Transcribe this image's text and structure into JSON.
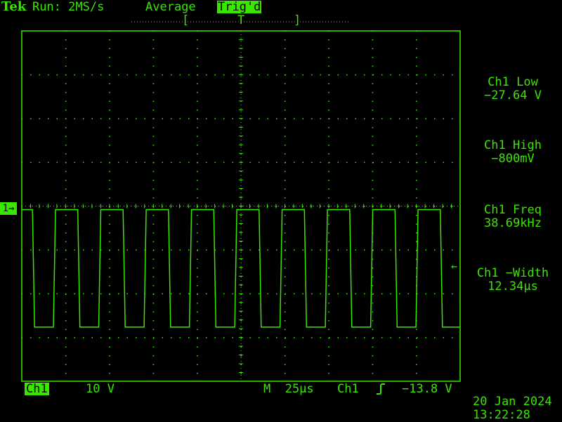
{
  "header": {
    "brand": "Tek",
    "run_status": "Run: 2MS/s",
    "acq_mode": "Average",
    "trigger_status": "Trig'd",
    "trigger_window": {
      "left_bracket": "[",
      "marker": "T",
      "right_bracket": "]"
    }
  },
  "channel_marker": "1→",
  "trigger_level_arrow": "←",
  "measurements": [
    {
      "label": "Ch1 Low",
      "value": "−27.64 V"
    },
    {
      "label": "Ch1 High",
      "value": "−800mV"
    },
    {
      "label": "Ch1 Freq",
      "value": "38.69kHz"
    },
    {
      "label": "Ch1 −Width",
      "value": "12.34µs"
    }
  ],
  "footer": {
    "channel": "Ch1",
    "volts_per_div": "10 V",
    "timebase": "M  25µs",
    "trigger_source": "Ch1",
    "trigger_slope_icon": "rising-edge",
    "trigger_level": "−13.8 V",
    "date": "20 Jan 2024",
    "time": "13:22:28"
  },
  "colors": {
    "trace": "#39e600",
    "background": "#000000"
  },
  "chart_data": {
    "type": "line",
    "description_units": "x in µs from left edge of screen, y in volts",
    "xlim": [
      0,
      250
    ],
    "ylim": [
      -40,
      40
    ],
    "grid": true,
    "waveform": "square",
    "high_level_v": -0.8,
    "low_level_v": -27.64,
    "frequency_khz": 38.69,
    "negative_width_us": 12.34
  }
}
